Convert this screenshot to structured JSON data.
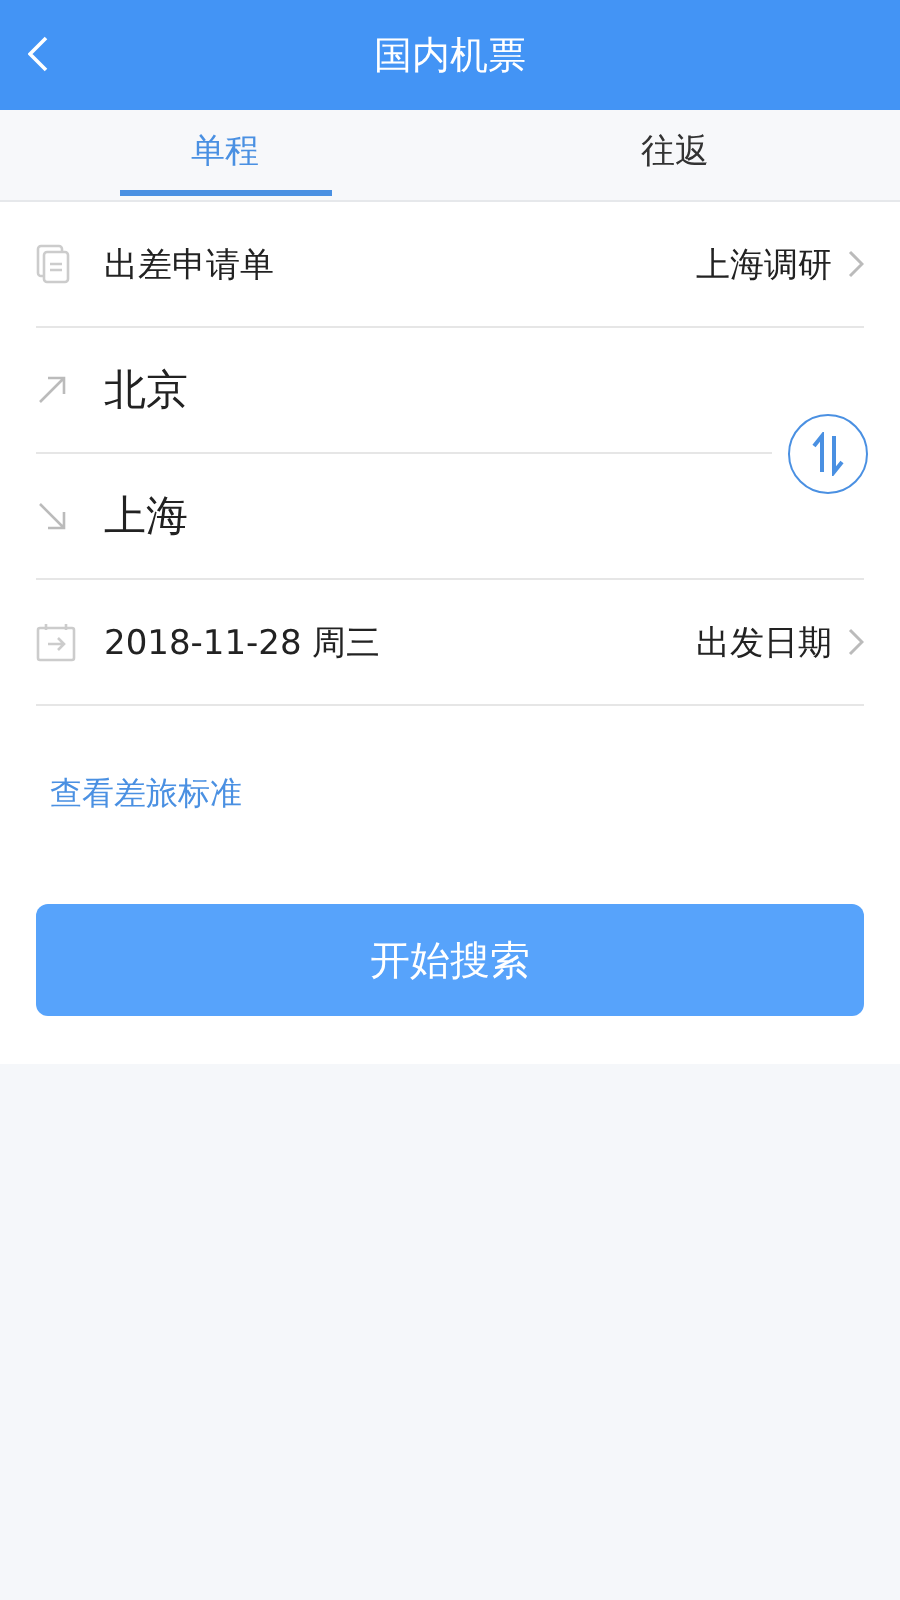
{
  "header": {
    "title": "国内机票"
  },
  "tabs": [
    {
      "label": "单程",
      "selected": true
    },
    {
      "label": "往返",
      "selected": false
    }
  ],
  "trip_request": {
    "label": "出差申请单",
    "value": "上海调研"
  },
  "route": {
    "from": "北京",
    "to": "上海"
  },
  "date": {
    "value": "2018-11-28 周三",
    "label": "出发日期"
  },
  "policy_link": "查看差旅标准",
  "search_button": "开始搜索"
}
